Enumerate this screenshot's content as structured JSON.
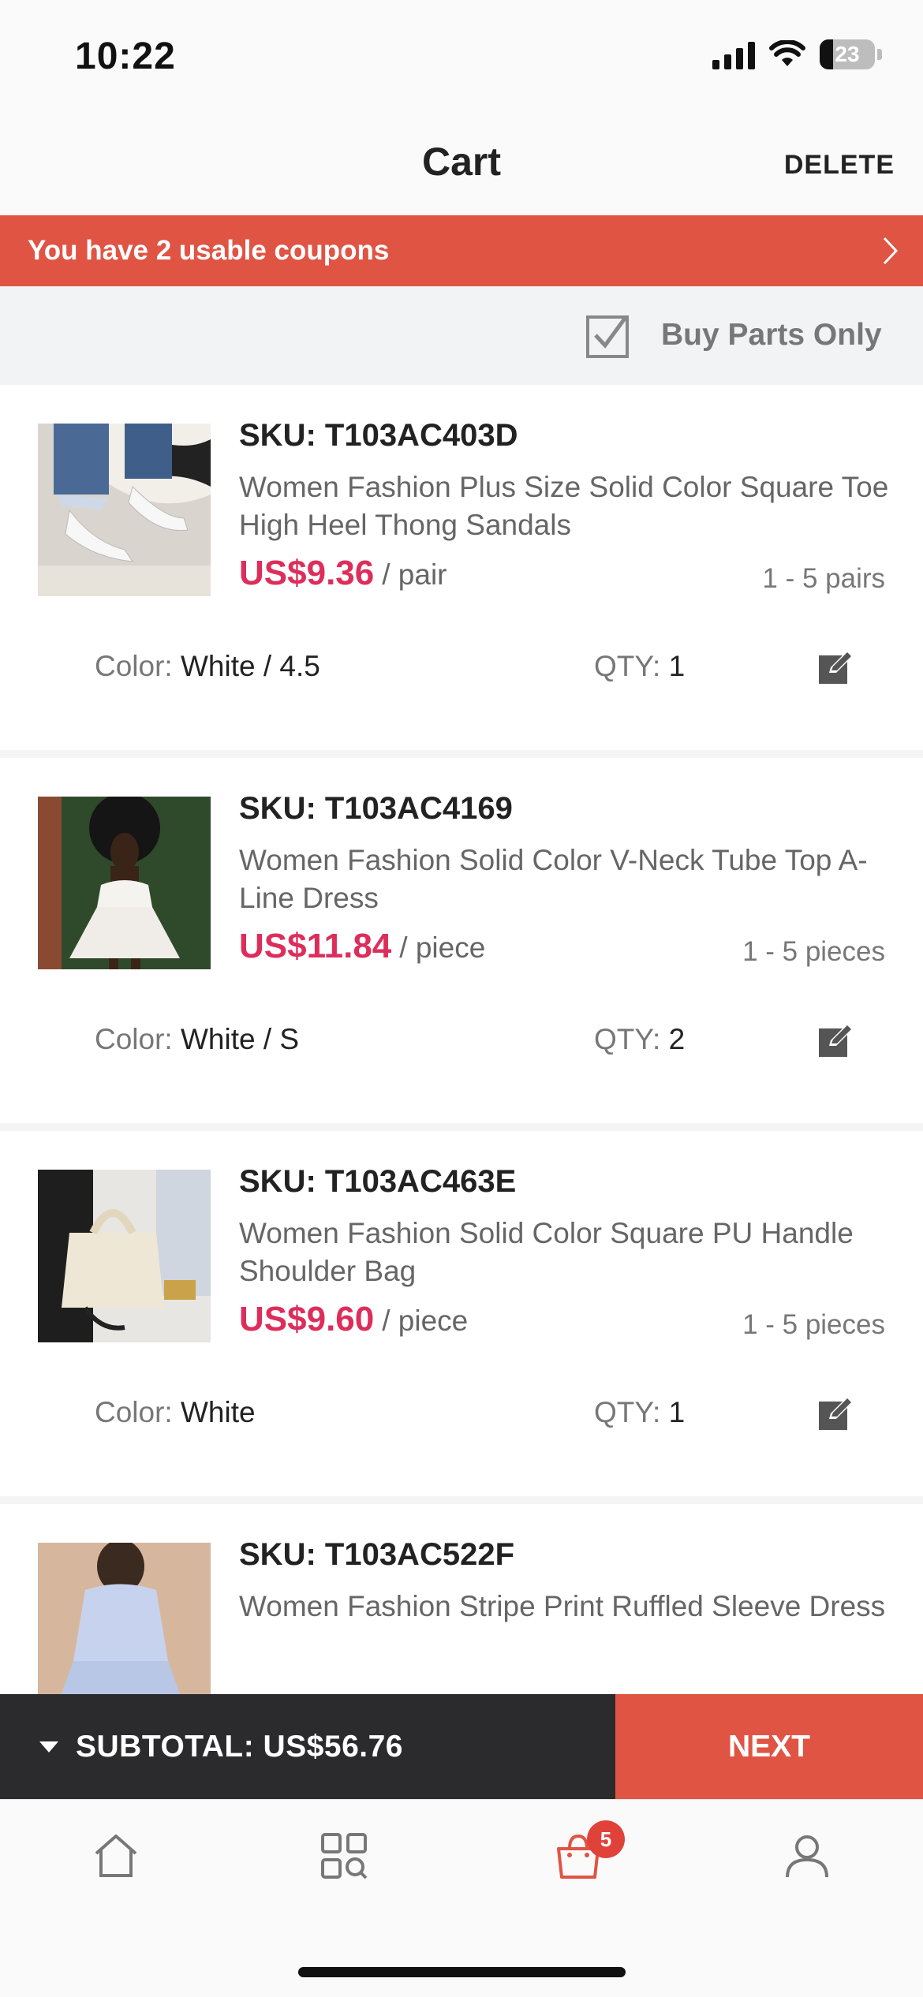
{
  "status_bar": {
    "time": "10:22",
    "battery": "23"
  },
  "header": {
    "title": "Cart",
    "delete_label": "DELETE"
  },
  "coupon": {
    "text": "You have 2 usable coupons"
  },
  "parts": {
    "label": "Buy Parts Only",
    "checked": true
  },
  "cart": {
    "items": [
      {
        "sku": "SKU: T103AC403D",
        "title": "Women Fashion Plus Size Solid Color Square Toe High Heel Thong Sandals",
        "price": "US$9.36",
        "unit": "/ pair",
        "range": "1 - 5 pairs",
        "variant_label": "Color:",
        "variant_value": "White / 4.5",
        "qty_label": "QTY:",
        "qty_value": "1"
      },
      {
        "sku": "SKU: T103AC4169",
        "title": "Women Fashion Solid Color V-Neck Tube Top A- Line Dress",
        "price": "US$11.84",
        "unit": "/ piece",
        "range": "1 - 5 pieces",
        "variant_label": "Color:",
        "variant_value": "White / S",
        "qty_label": "QTY:",
        "qty_value": "2"
      },
      {
        "sku": "SKU: T103AC463E",
        "title": "Women Fashion Solid Color Square PU Handle Shoulder Bag",
        "price": "US$9.60",
        "unit": "/ piece",
        "range": "1 - 5 pieces",
        "variant_label": "Color:",
        "variant_value": "White",
        "qty_label": "QTY:",
        "qty_value": "1"
      },
      {
        "sku": "SKU: T103AC522F",
        "title": "Women Fashion Stripe Print Ruffled Sleeve Dress"
      }
    ]
  },
  "checkout": {
    "subtotal": "SUBTOTAL: US$56.76",
    "next_label": "NEXT"
  },
  "tab_bar": {
    "cart_badge": "5"
  },
  "colors": {
    "accent": "#e05444",
    "price": "#dd2e5b",
    "dark_bar": "#2b2b2d"
  }
}
